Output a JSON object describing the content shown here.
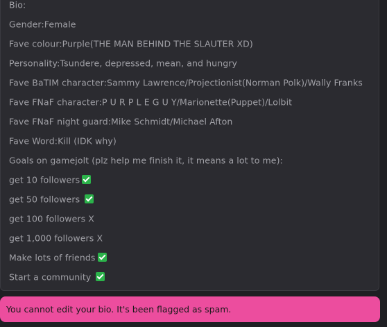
{
  "bio": {
    "lines": [
      {
        "text": "Bio:",
        "check": false
      },
      {
        "text": "Gender:Female",
        "check": false
      },
      {
        "text": "Fave colour:Purple(THE MAN BEHIND THE SLAUTER XD)",
        "check": false
      },
      {
        "text": "Personality:Tsundere, depressed, mean, and hungry",
        "check": false
      },
      {
        "text": "Fave BaTIM character:Sammy Lawrence/Projectionist(Norman Polk)/Wally Franks",
        "check": false
      },
      {
        "text": "Fave FNaF character:P U R P L E G U Y/Marionette(Puppet)/Lolbit",
        "check": false
      },
      {
        "text": "Fave FNaF night guard:Mike Schmidt/Michael Afton",
        "check": false
      },
      {
        "text": "Fave Word:Kill (IDK why)",
        "check": false
      },
      {
        "text": "Goals on gamejolt (plz help me finish it, it means a lot to me):",
        "check": false
      },
      {
        "text": "get 10 followers",
        "check": true
      },
      {
        "text": "get 50 followers ",
        "check": true
      },
      {
        "text": "get 100 followers X",
        "check": false
      },
      {
        "text": "get 1,000 followers X",
        "check": false
      },
      {
        "text": "Make lots of friends",
        "check": true
      },
      {
        "text": "Start a community ",
        "check": true
      }
    ],
    "check_icon": "white-heavy-check-mark-icon",
    "check_color": "#2bb34a"
  },
  "banner": {
    "message": "You cannot edit your bio. It's been flagged as spam.",
    "color": "#ec4d9e"
  }
}
